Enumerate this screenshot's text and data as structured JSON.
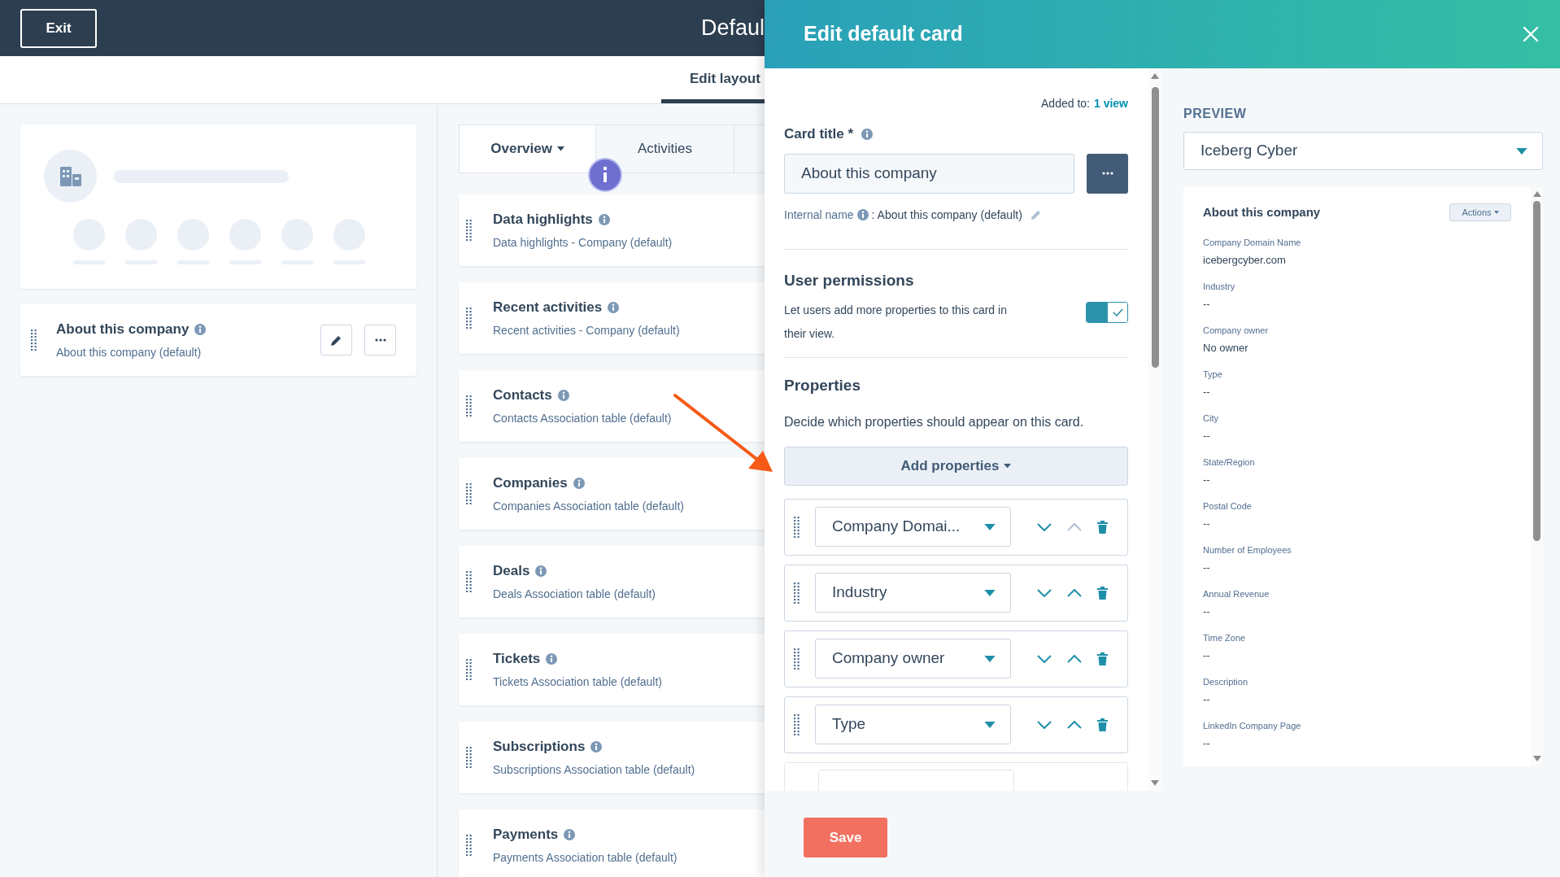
{
  "top_bar": {
    "exit_button": "Exit",
    "title": "Defaul"
  },
  "layout_tabs": [
    {
      "label": "Edit layout",
      "selected": true
    }
  ],
  "left_cards": [
    {
      "title": "About this company",
      "subtitle": "About this company (default)"
    }
  ],
  "tabs": [
    {
      "label": "Overview",
      "selected": true
    },
    {
      "label": "Activities",
      "selected": false
    }
  ],
  "cards": [
    {
      "title": "Data highlights",
      "subtitle": "Data highlights - Company (default)"
    },
    {
      "title": "Recent activities",
      "subtitle": "Recent activities - Company (default)"
    },
    {
      "title": "Contacts",
      "subtitle": "Contacts Association table (default)"
    },
    {
      "title": "Companies",
      "subtitle": "Companies Association table (default)"
    },
    {
      "title": "Deals",
      "subtitle": "Deals Association table (default)"
    },
    {
      "title": "Tickets",
      "subtitle": "Tickets Association table (default)"
    },
    {
      "title": "Subscriptions",
      "subtitle": "Subscriptions Association table (default)"
    },
    {
      "title": "Payments",
      "subtitle": "Payments Association table (default)"
    }
  ],
  "panel": {
    "title": "Edit default card",
    "added_to_label": "Added to:",
    "added_to_link": "1 view",
    "card_title_label": "Card title *",
    "card_title_value": "About this company",
    "internal_name_label": "Internal name",
    "internal_name_value": ": About this company (default)",
    "permissions_heading": "User permissions",
    "permissions_text": "Let users add more properties to this card in their view.",
    "permissions_toggle": {
      "on": true
    },
    "properties_heading": "Properties",
    "properties_text": "Decide which properties should appear on this card.",
    "add_button": "Add properties",
    "property_rows": [
      {
        "label": "Company Domai...",
        "up_disabled": true
      },
      {
        "label": "Industry",
        "up_disabled": false
      },
      {
        "label": "Company owner",
        "up_disabled": false
      },
      {
        "label": "Type",
        "up_disabled": false
      }
    ],
    "save_button": "Save"
  },
  "preview": {
    "label": "PREVIEW",
    "record": "Iceberg Cyber",
    "card_title": "About this company",
    "actions_button": "Actions",
    "fields": [
      {
        "label": "Company Domain Name",
        "value": "icebergcyber.com"
      },
      {
        "label": "Industry",
        "value": "--"
      },
      {
        "label": "Company owner",
        "value": "No owner"
      },
      {
        "label": "Type",
        "value": "--"
      },
      {
        "label": "City",
        "value": "--"
      },
      {
        "label": "State/Region",
        "value": "--"
      },
      {
        "label": "Postal Code",
        "value": "--"
      },
      {
        "label": "Number of Employees",
        "value": "--"
      },
      {
        "label": "Annual Revenue",
        "value": "--"
      },
      {
        "label": "Time Zone",
        "value": "--"
      },
      {
        "label": "Description",
        "value": "--"
      },
      {
        "label": "LinkedIn Company Page",
        "value": "--"
      }
    ]
  }
}
